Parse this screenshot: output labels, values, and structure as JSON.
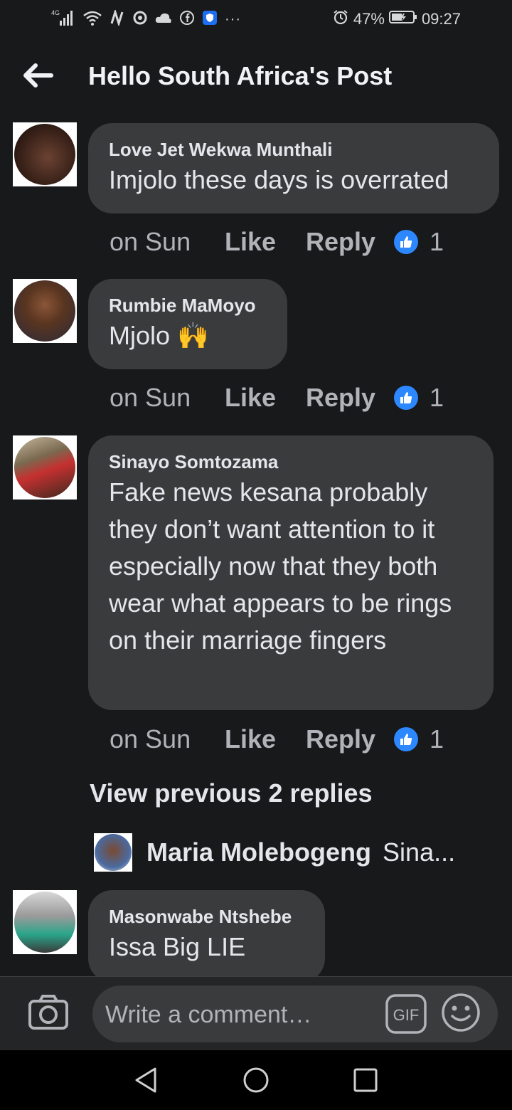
{
  "status_bar": {
    "network": "4G",
    "battery": "47%",
    "time": "09:27",
    "more": "···",
    "icons": [
      "signal-icon",
      "wifi-icon",
      "nfc-icon",
      "sync-icon",
      "cloud-icon",
      "facebook-icon",
      "shield-app-icon",
      "alarm-icon",
      "battery-icon"
    ]
  },
  "header": {
    "title": "Hello South Africa's Post",
    "back_icon": "arrow-left-icon"
  },
  "comments": [
    {
      "author": "Love Jet Wekwa Munthali",
      "text": "Imjolo these days is overrated",
      "time": "on Sun",
      "like": "Like",
      "reply": "Reply",
      "reaction_count": "1"
    },
    {
      "author": "Rumbie MaMoyo",
      "text": "Mjolo 🙌",
      "time": "on Sun",
      "like": "Like",
      "reply": "Reply",
      "reaction_count": "1"
    },
    {
      "author": "Sinayo Somtozama",
      "text": "Fake news kesana probably they don’t want attention to it especially now that they both wear what appears to be rings on their marriage fingers",
      "time": "on Sun",
      "like": "Like",
      "reply": "Reply",
      "reaction_count": "1"
    },
    {
      "author": "Masonwabe Ntshebe",
      "text": "Issa Big LIE"
    }
  ],
  "view_previous": "View previous 2 replies",
  "reply_preview": {
    "name": "Maria Molebogeng",
    "preview": "Sina..."
  },
  "composer": {
    "placeholder": "Write a comment…",
    "gif_label": "GIF",
    "icons": [
      "camera-icon",
      "gif-icon",
      "emoji-icon"
    ]
  },
  "colors": {
    "background": "#18191a",
    "bubble": "#3a3b3c",
    "text": "#e4e6eb",
    "muted": "#b0b3b8",
    "like_blue": "#2d88ff"
  }
}
